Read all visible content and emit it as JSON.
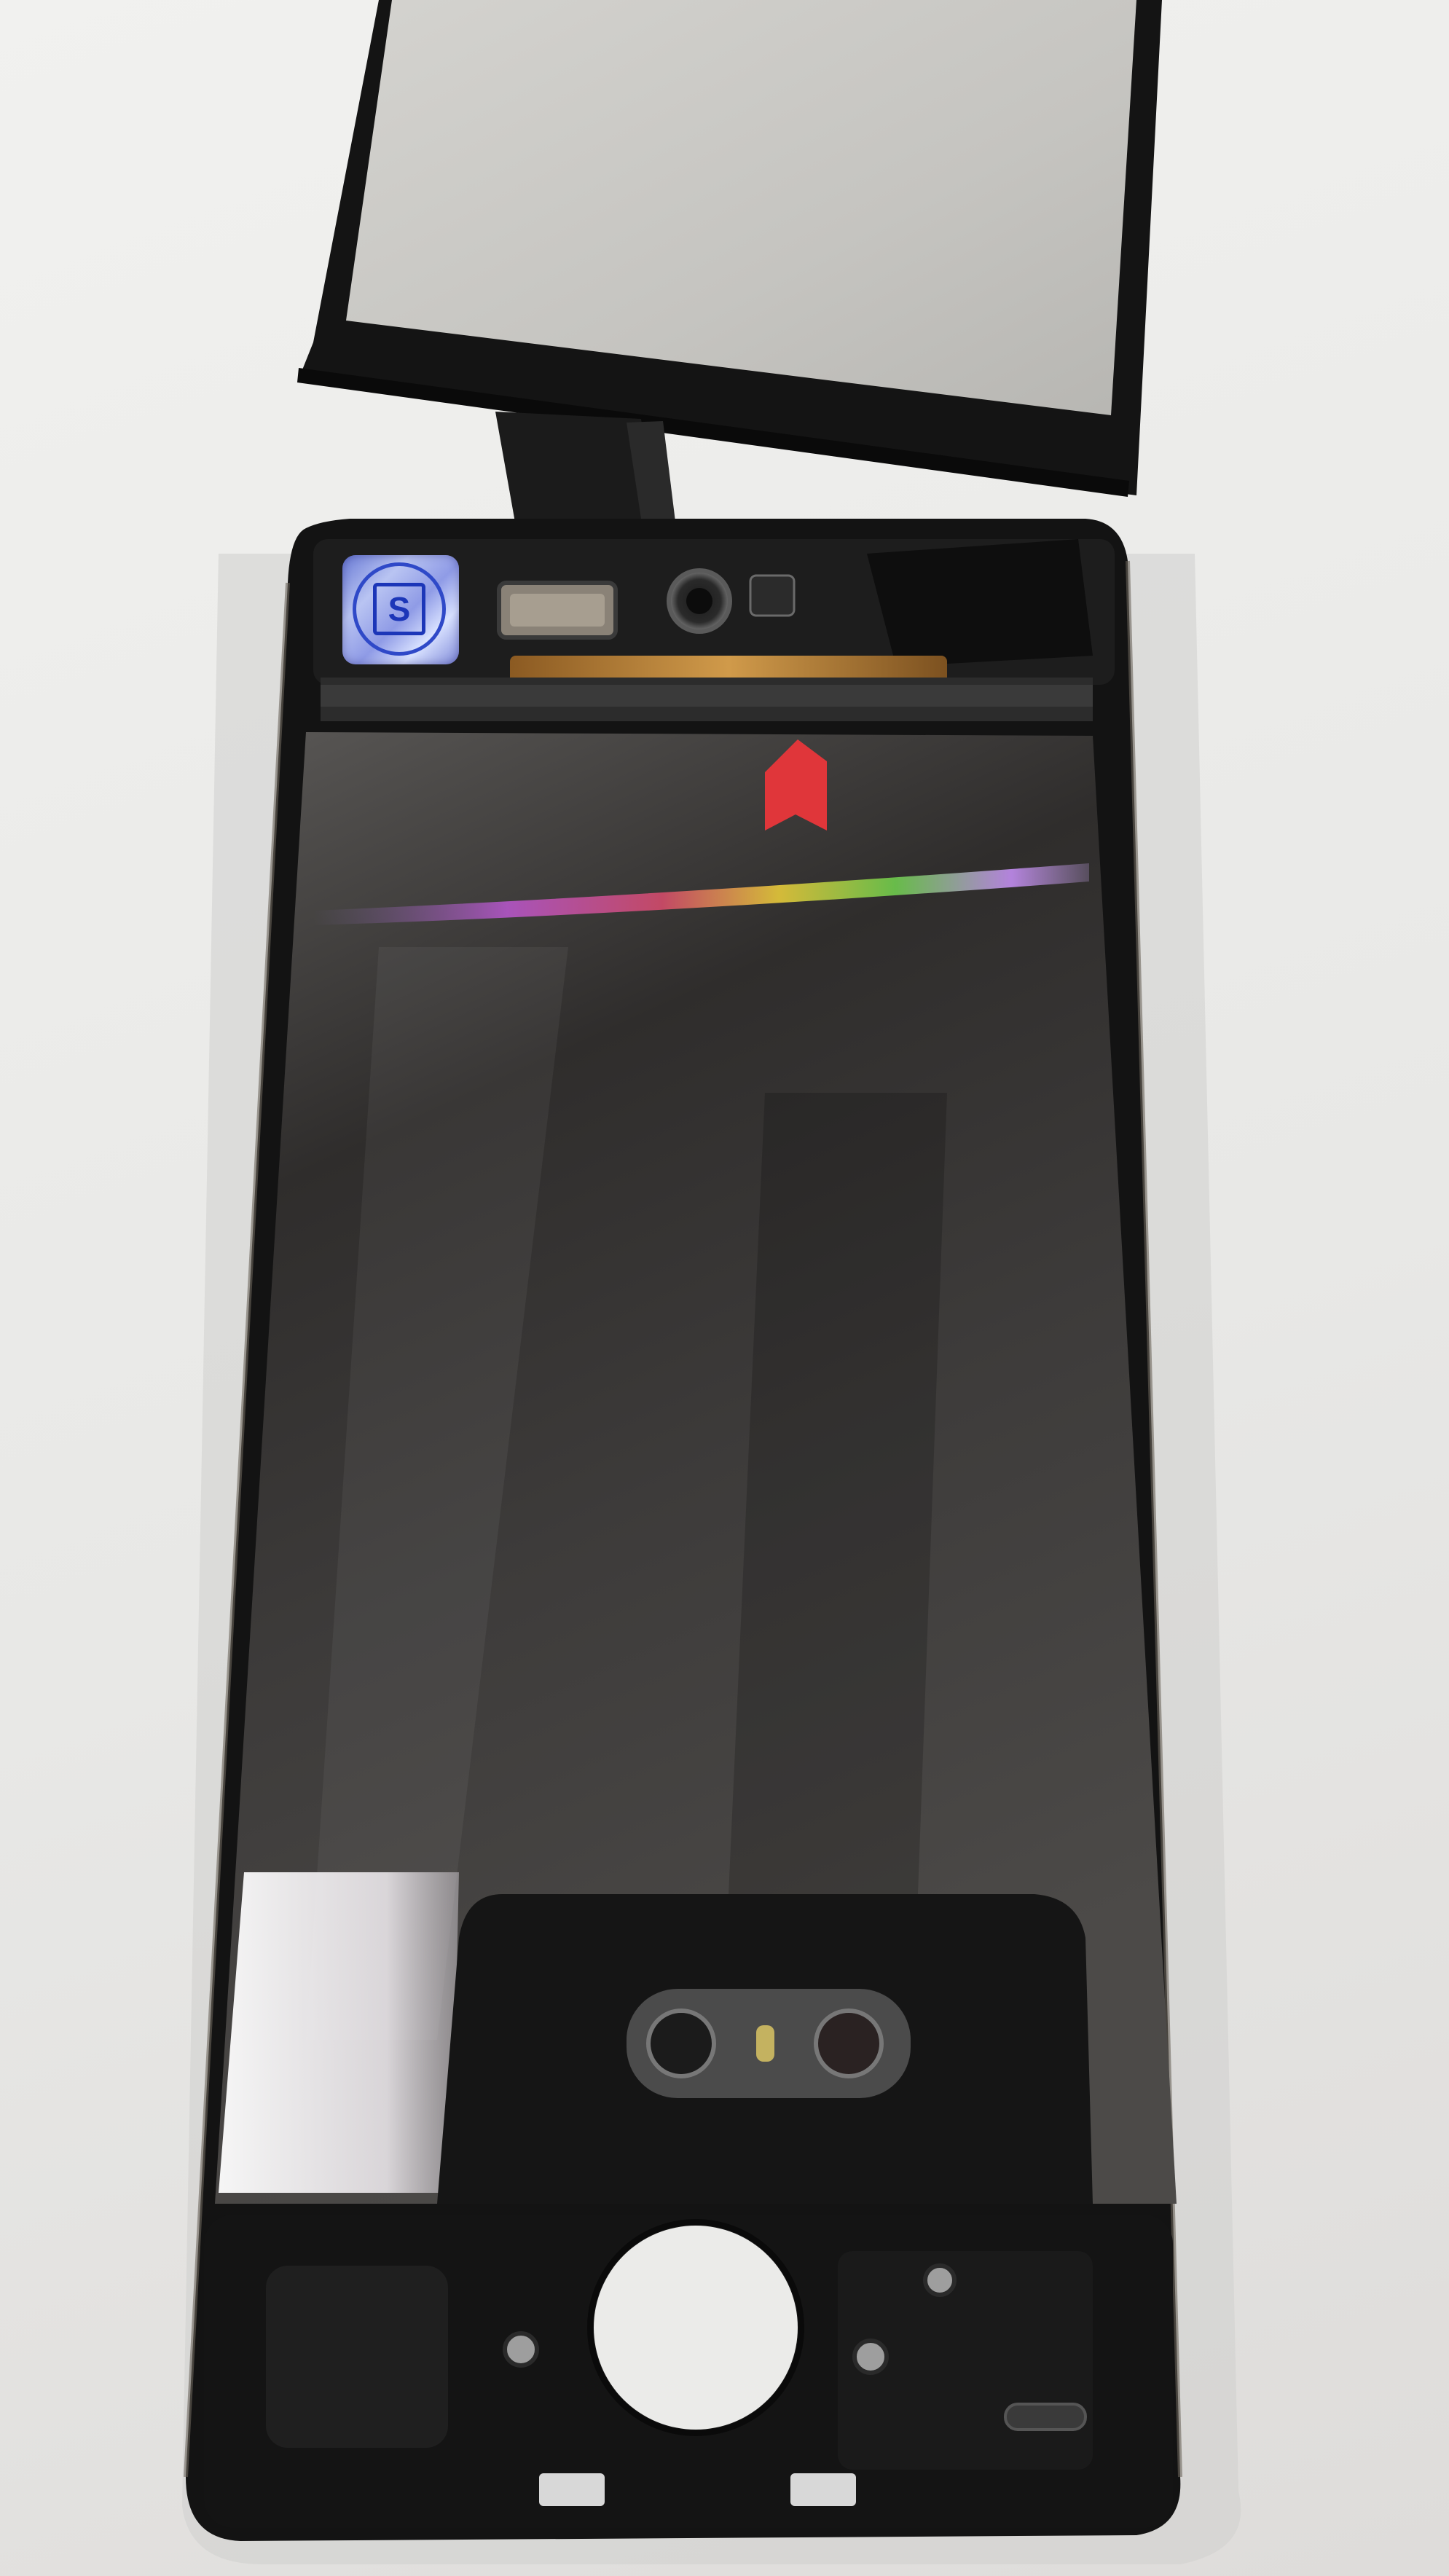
{
  "photo": {
    "subject": "disassembled-phone-screen-assembly",
    "colors": {
      "background": "#ebebe9",
      "frame": "#121212",
      "panel": "#3f3d3b",
      "lifted_panel": "#c7c6c1",
      "flex_cable": "#c28a3a",
      "red_tab": "#e0363a",
      "seal": "#3a55d6"
    }
  },
  "seal_sticker": {
    "letter": "S",
    "icon": "shield-s-hologram"
  }
}
